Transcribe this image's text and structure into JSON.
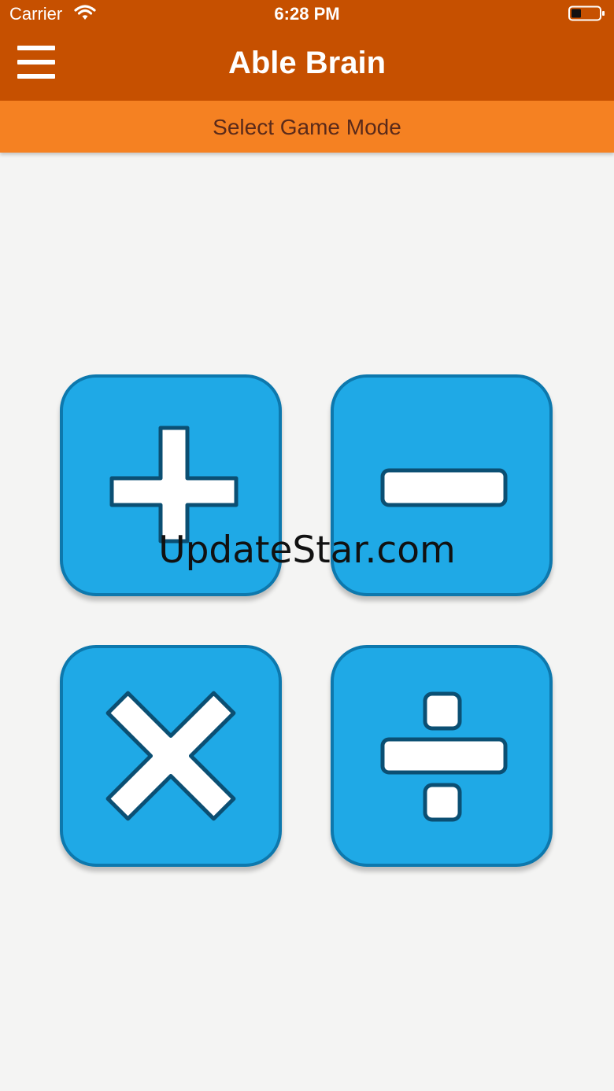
{
  "status_bar": {
    "carrier": "Carrier",
    "time": "6:28 PM",
    "wifi_icon": "wifi-icon",
    "battery_icon": "battery-icon"
  },
  "nav_bar": {
    "title": "Able Brain",
    "menu_icon": "hamburger-menu-icon"
  },
  "sub_header": {
    "title": "Select Game Mode"
  },
  "modes": [
    {
      "name": "addition",
      "icon": "plus-icon"
    },
    {
      "name": "subtraction",
      "icon": "minus-icon"
    },
    {
      "name": "multiplication",
      "icon": "multiply-icon"
    },
    {
      "name": "division",
      "icon": "divide-icon"
    }
  ],
  "watermark": "UpdateStar.com",
  "colors": {
    "nav_bar": "#c65000",
    "sub_header": "#f58122",
    "sub_header_text": "#5a2a1a",
    "button_fill": "#1fa9e6",
    "button_border": "#0d78ad",
    "icon_outline": "#0b4f73",
    "background": "#f4f4f3"
  }
}
